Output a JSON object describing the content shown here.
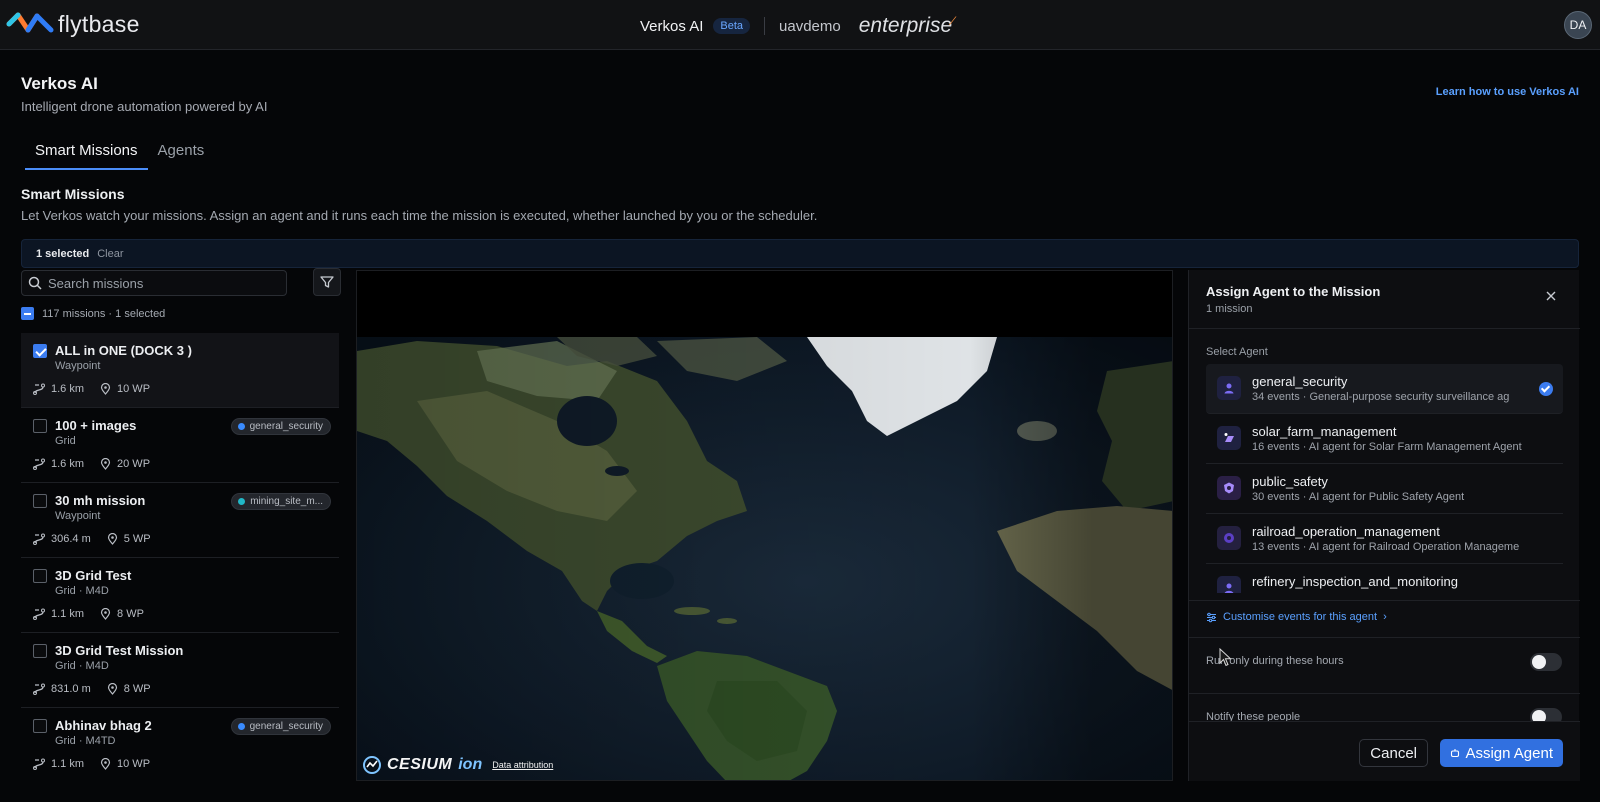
{
  "header": {
    "logo_text": "flytbase",
    "app_name": "Verkos AI",
    "beta_badge": "Beta",
    "org_name": "uavdemo",
    "plan": "enterprise",
    "avatar_initials": "DA"
  },
  "page": {
    "title": "Verkos AI",
    "subtitle": "Intelligent drone automation powered by AI",
    "learn_link": "Learn how to use Verkos AI",
    "tabs": [
      {
        "label": "Smart Missions",
        "active": true
      },
      {
        "label": "Agents",
        "active": false
      }
    ],
    "section_title": "Smart Missions",
    "section_subtitle": "Let Verkos watch your missions. Assign an agent and it runs each time the mission is executed, whether launched by you or the scheduler."
  },
  "selection_bar": {
    "count": "1 selected",
    "clear": "Clear"
  },
  "search": {
    "placeholder": "Search missions",
    "value": ""
  },
  "mission_summary": "117 missions · 1 selected",
  "missions": [
    {
      "name": "ALL in ONE (DOCK 3 )",
      "type": "Waypoint",
      "distance": "1.6 km",
      "waypoints": "10 WP",
      "tag": "",
      "checked": true
    },
    {
      "name": "100 + images",
      "type": "Grid",
      "distance": "1.6 km",
      "waypoints": "20 WP",
      "tag": "general_security",
      "checked": false
    },
    {
      "name": "30 mh mission",
      "type": "Waypoint",
      "distance": "306.4 m",
      "waypoints": "5 WP",
      "tag": "mining_site_m...",
      "checked": false
    },
    {
      "name": "3D Grid Test",
      "type": "Grid · M4D",
      "distance": "1.1 km",
      "waypoints": "8 WP",
      "tag": "",
      "checked": false
    },
    {
      "name": "3D Grid Test Mission",
      "type": "Grid · M4D",
      "distance": "831.0 m",
      "waypoints": "8 WP",
      "tag": "",
      "checked": false
    },
    {
      "name": "Abhinav bhag 2",
      "type": "Grid · M4TD",
      "distance": "1.1 km",
      "waypoints": "10 WP",
      "tag": "general_security",
      "checked": false
    }
  ],
  "map": {
    "brand": "CESIUM",
    "brand_suffix": "ion",
    "attribution": "Data attribution"
  },
  "assign_panel": {
    "title": "Assign Agent to the Mission",
    "subtitle": "1 mission",
    "select_label": "Select Agent",
    "agents": [
      {
        "name": "general_security",
        "desc": "34 events · General-purpose security surveillance ag",
        "selected": true
      },
      {
        "name": "solar_farm_management",
        "desc": "16 events · AI agent for Solar Farm Management Agent",
        "selected": false
      },
      {
        "name": "public_safety",
        "desc": "30 events · AI agent for Public Safety Agent",
        "selected": false
      },
      {
        "name": "railroad_operation_management",
        "desc": "13 events · AI agent for Railroad Operation Manageme",
        "selected": false
      },
      {
        "name": "refinery_inspection_and_monitoring",
        "desc": "",
        "selected": false
      }
    ],
    "customise_link": "Customise events for this agent",
    "run_hours_label": "Run only during these hours",
    "notify_label": "Notify these people",
    "cancel": "Cancel",
    "assign": "Assign Agent"
  },
  "colors": {
    "accent": "#3b7cf0",
    "link": "#5aa0ff",
    "background": "#050608"
  }
}
